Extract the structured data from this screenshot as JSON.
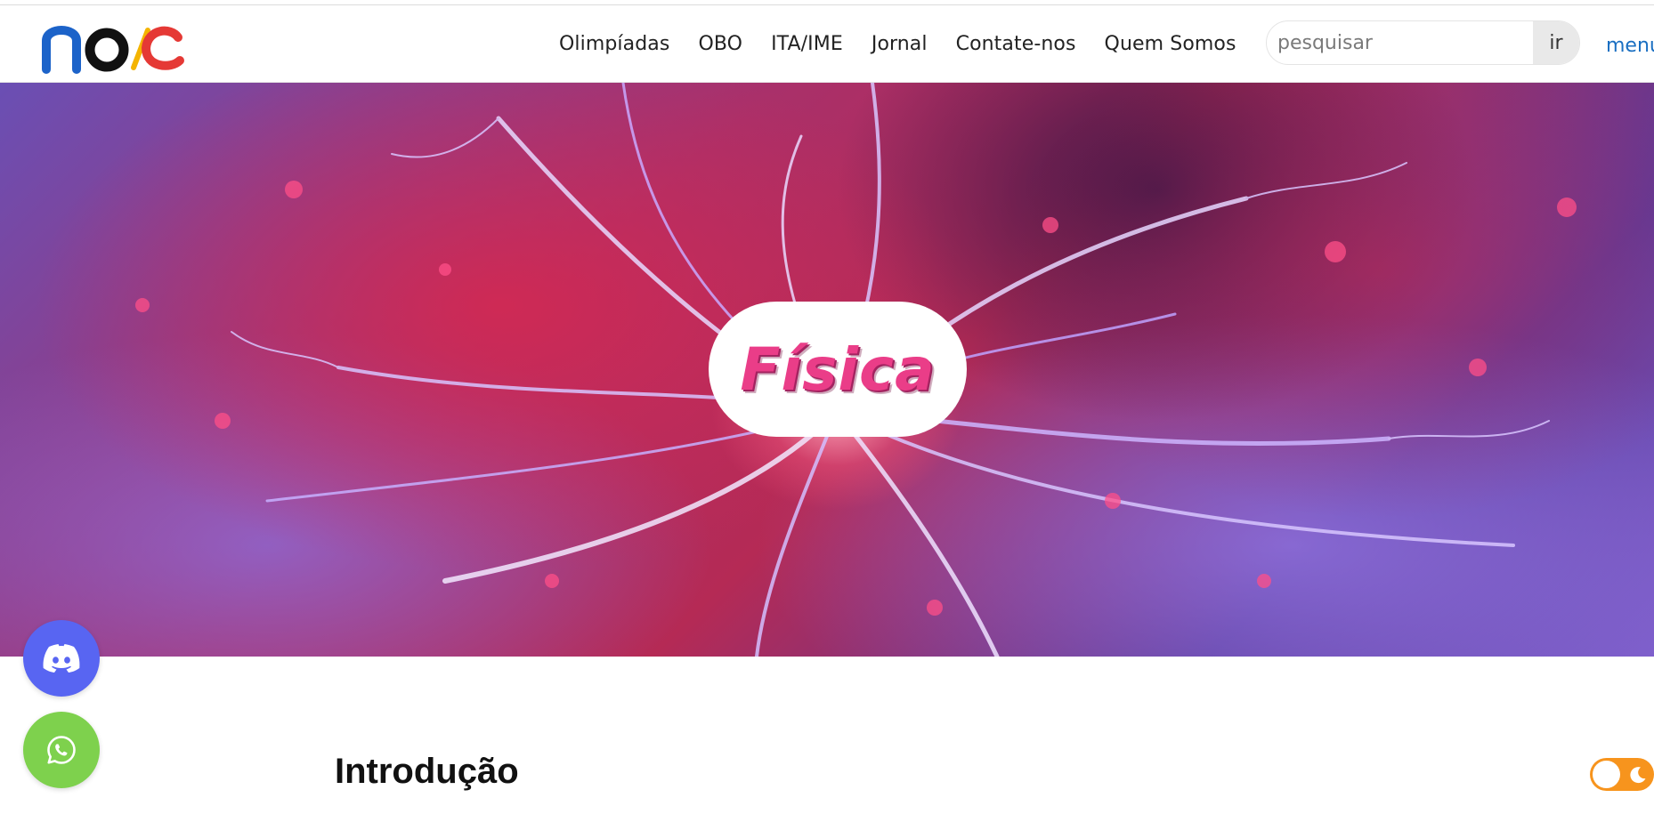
{
  "brand": {
    "logo_text": "noic"
  },
  "nav": {
    "items": [
      {
        "label": "Olimpíadas"
      },
      {
        "label": "OBO"
      },
      {
        "label": "ITA/IME"
      },
      {
        "label": "Jornal"
      },
      {
        "label": "Contate-nos"
      },
      {
        "label": "Quem Somos"
      }
    ],
    "menu_label": "menu"
  },
  "search": {
    "placeholder": "pesquisar",
    "value": "",
    "button_label": "ir"
  },
  "hero": {
    "title": "Física"
  },
  "floating": {
    "discord_icon": "discord-icon",
    "whatsapp_icon": "whatsapp-icon"
  },
  "content": {
    "section_title": "Introdução"
  },
  "theme_toggle": {
    "state": "light",
    "icon": "moon-icon"
  },
  "colors": {
    "link_blue": "#1a6fc2",
    "hero_title_pink": "#ea3d88",
    "discord": "#5865f2",
    "whatsapp": "#7ed14d",
    "toggle_orange": "#f7941d"
  }
}
